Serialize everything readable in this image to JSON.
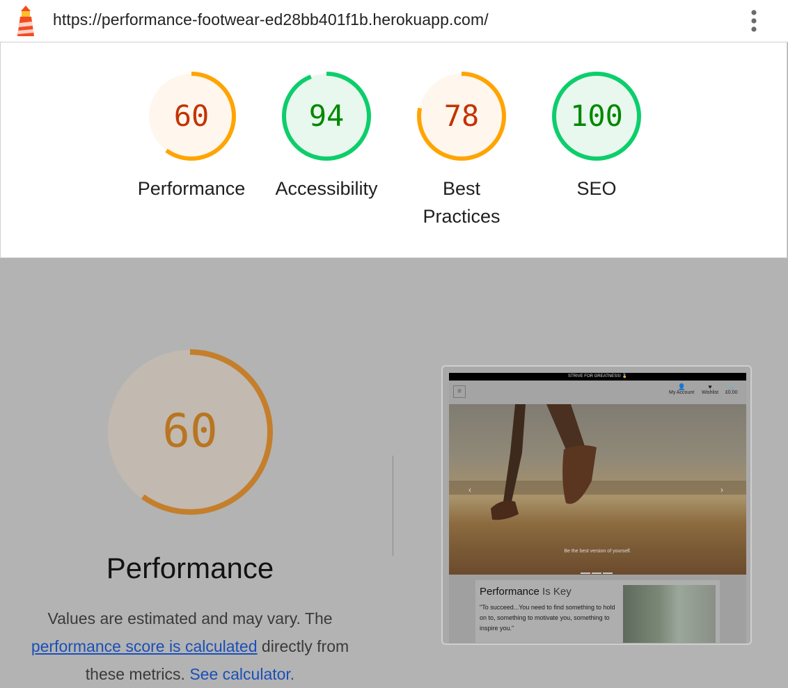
{
  "browser": {
    "url": "https://performance-footwear-ed28bb401f1b.herokuapp.com/",
    "icon": "lighthouse-icon",
    "menu_icon": "kebab-menu-icon"
  },
  "scores": [
    {
      "label": "Performance",
      "score": "60",
      "fraction": 0.6,
      "ring_color": "#ffa400",
      "text_color": "#c33300",
      "fill_color": "#fff6ed"
    },
    {
      "label": "Accessibility",
      "score": "94",
      "fraction": 0.94,
      "ring_color": "#0cce6b",
      "text_color": "#008800",
      "fill_color": "#e8f8ee"
    },
    {
      "label": "Best Practices",
      "score": "78",
      "fraction": 0.78,
      "ring_color": "#ffa400",
      "text_color": "#c33300",
      "fill_color": "#fff6ed"
    },
    {
      "label": "SEO",
      "score": "100",
      "fraction": 1.0,
      "ring_color": "#0cce6b",
      "text_color": "#008800",
      "fill_color": "#e8f8ee"
    }
  ],
  "performance_detail": {
    "score": "60",
    "fraction": 0.6,
    "title": "Performance",
    "desc_before": "Values are estimated and may vary. The ",
    "desc_link": "performance score is calculated",
    "desc_middle": " directly from these metrics. ",
    "desc_calc_link": "See calculator."
  },
  "thumbnail": {
    "announcement": "STRIVE FOR GREATNESS! 🏅",
    "nav": {
      "account": "My Account",
      "wishlist": "Wishlist",
      "cart": "£0.00"
    },
    "hero_caption": "Be the best version of yourself.",
    "card_title_main": "Performance",
    "card_title_accent": " Is Key",
    "card_quote": "\"To succeed...You need to find something to hold on to, something to motivate you, something to inspire you.\""
  }
}
